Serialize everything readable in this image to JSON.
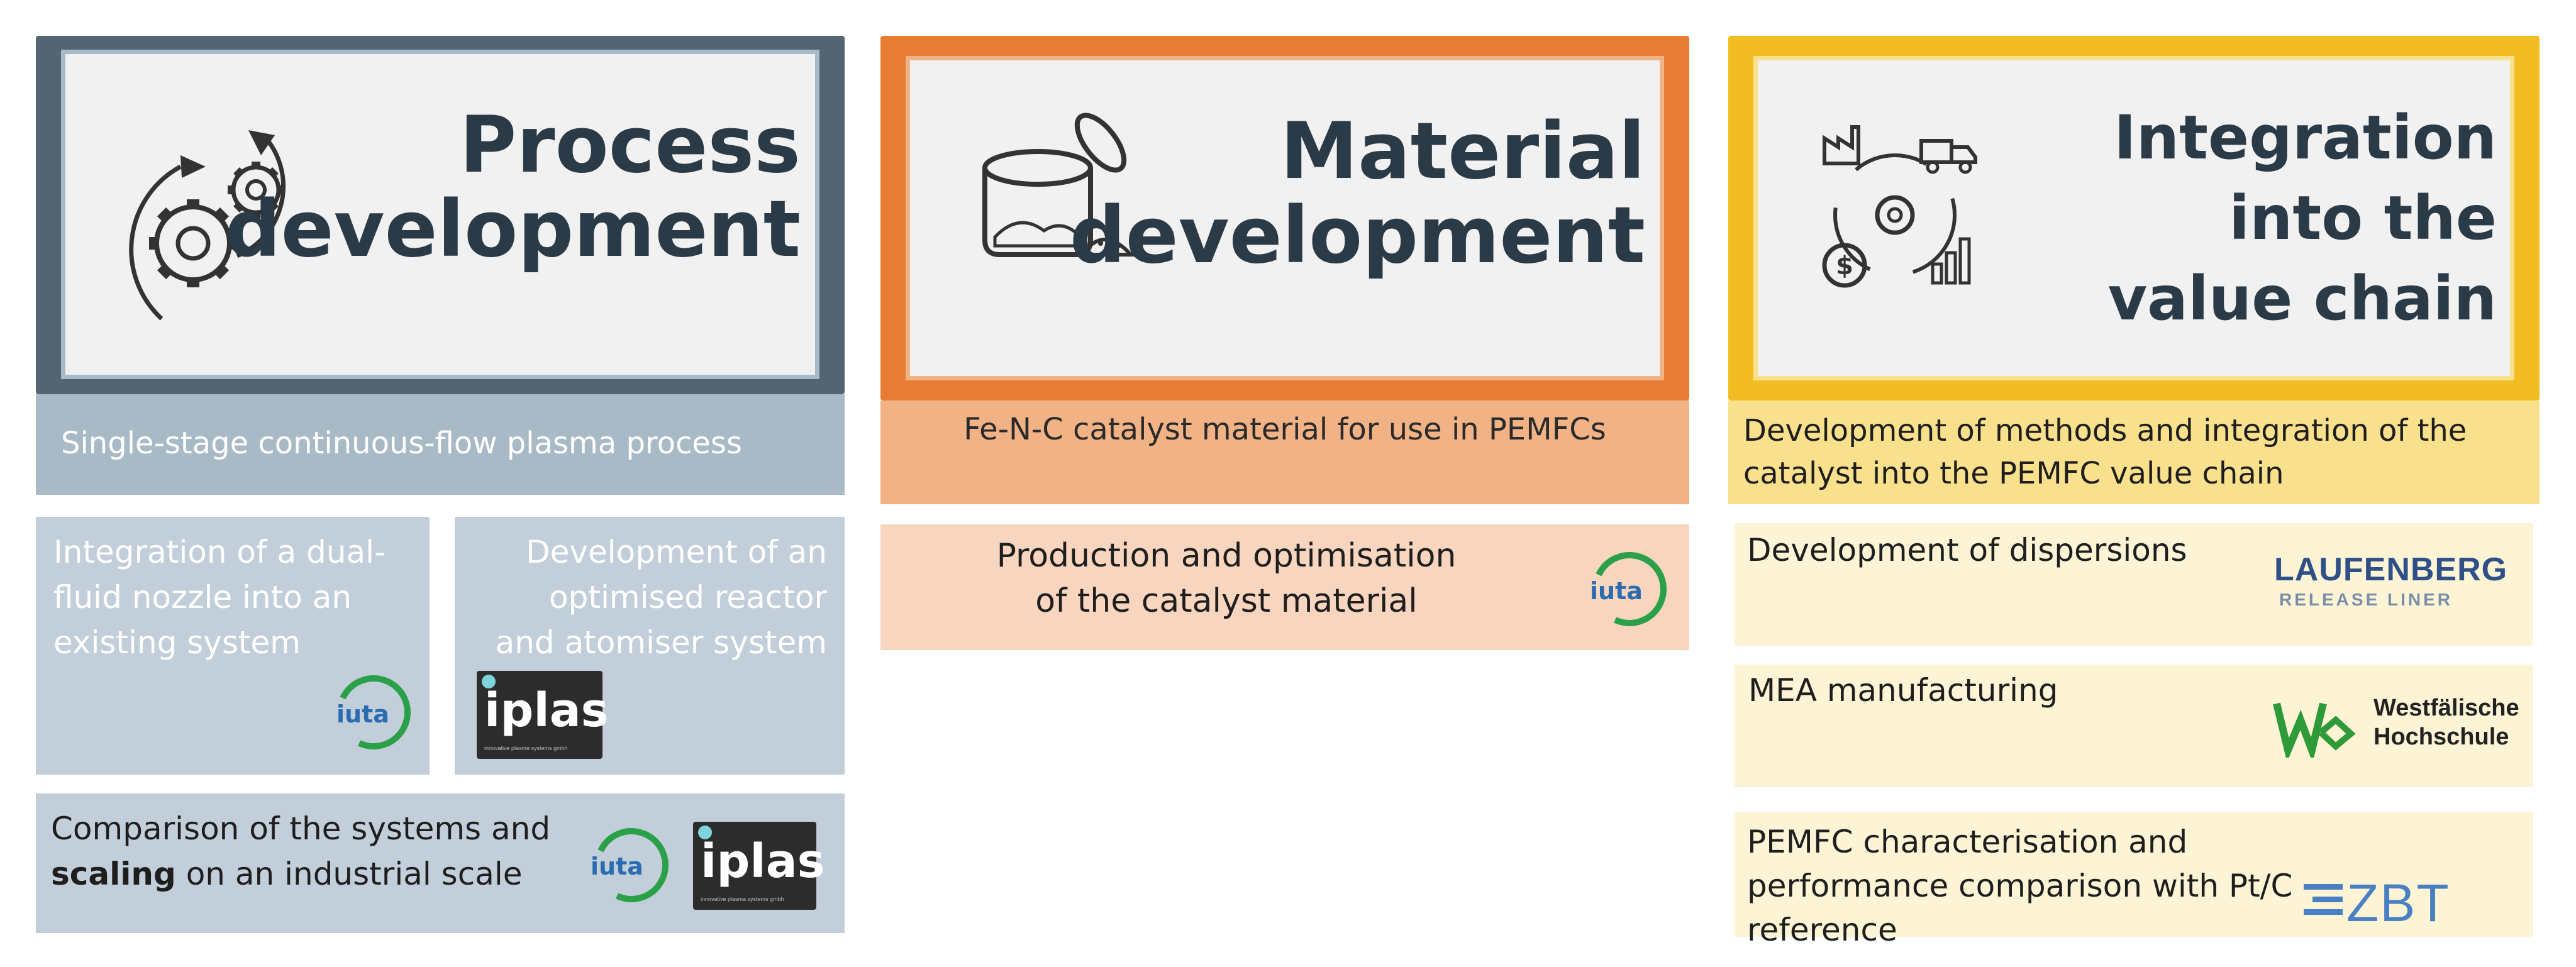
{
  "columns": {
    "process": {
      "title_line1": "Process",
      "title_line2": "development",
      "subtitle": "Single-stage continuous-flow plasma process",
      "task1": "Integration of a dual-fluid nozzle into an existing system",
      "task2": "Development of an optimised reactor and atomiser system",
      "task3_pre": "Comparison of the systems and",
      "task3_bold": "scaling",
      "task3_post": "on an industrial scale",
      "colors": {
        "frame": "#536573",
        "light": "#a9bac7",
        "task": "#c2cfda"
      }
    },
    "material": {
      "title_line1": "Material",
      "title_line2": "development",
      "subtitle": "Fe-N-C catalyst material for use in PEMFCs",
      "task1": "Production and optimisation of the catalyst material",
      "colors": {
        "frame": "#e77d34",
        "light": "#f1b386",
        "task": "#f7d5bf"
      }
    },
    "integration": {
      "title_line1": "Integration",
      "title_line2": "into the",
      "title_line3": "value chain",
      "subtitle": "Development of methods and integration of the catalyst into the PEMFC value chain",
      "task1": "Development of dispersions",
      "task2": "MEA manufacturing",
      "task3": "PEMFC characterisation and performance comparison with Pt/C reference",
      "colors": {
        "frame": "#f2bd22",
        "light": "#f9e08d",
        "task": "#fdf4d6"
      }
    }
  },
  "logos": {
    "iuta": "iuta",
    "iplas": "iplas",
    "iplas_tagline": "innovative plasma systems gmbh",
    "laufenberg_1": "LAUFENBERG",
    "laufenberg_2": "RELEASE LINER",
    "whs_1": "Westfälische",
    "whs_2": "Hochschule",
    "zbt": "ZBT"
  },
  "icons": [
    "gears-cycle-icon",
    "powder-jar-icon",
    "value-chain-cycle-icon"
  ]
}
